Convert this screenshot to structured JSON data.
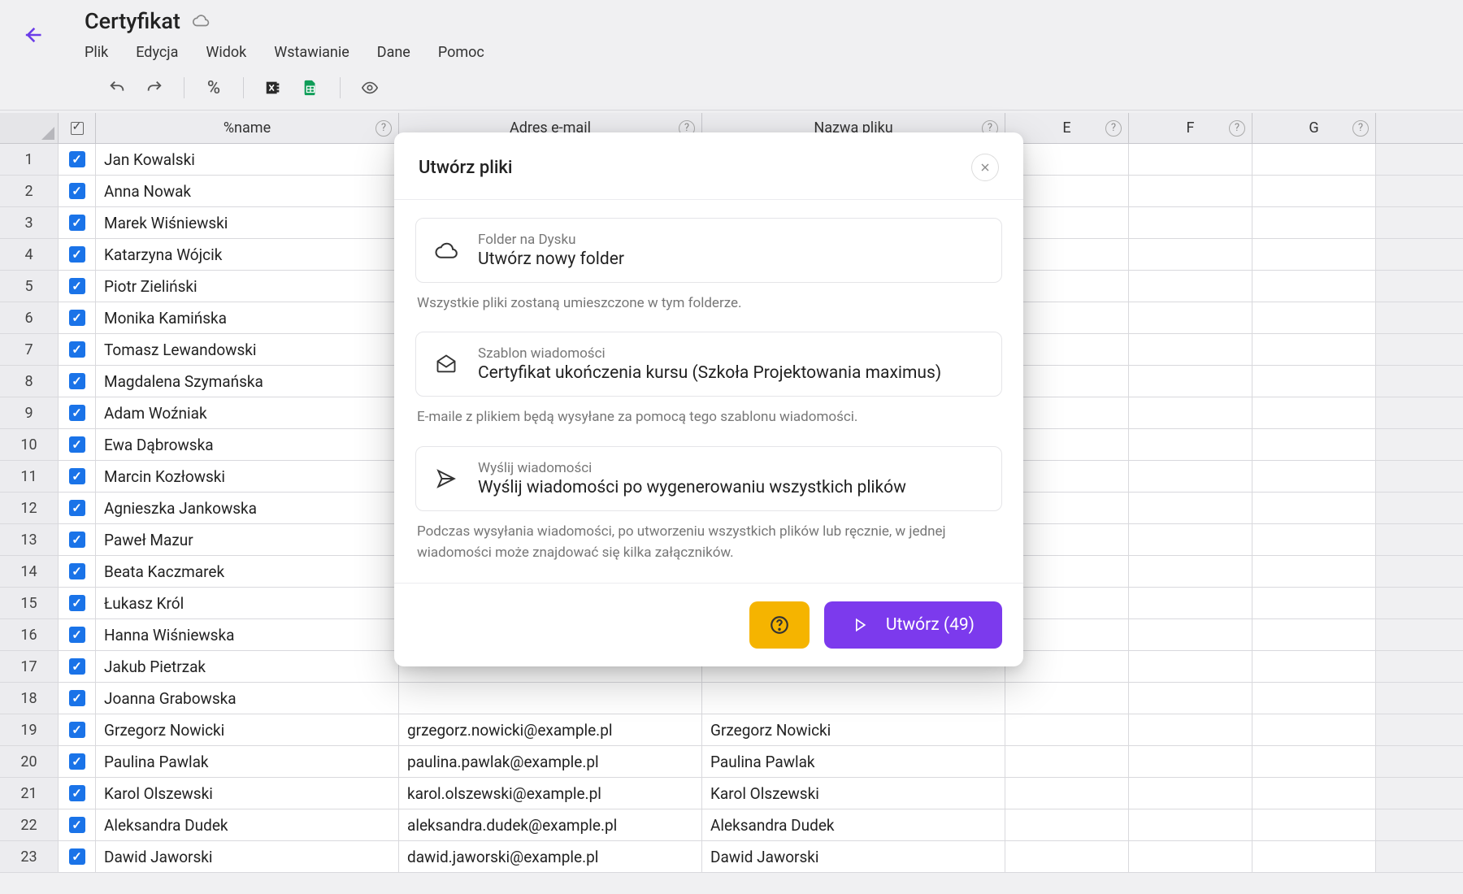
{
  "header": {
    "title": "Certyfikat",
    "menus": [
      "Plik",
      "Edycja",
      "Widok",
      "Wstawianie",
      "Dane",
      "Pomoc"
    ]
  },
  "columns": {
    "name": "%name",
    "email": "Adres e-mail",
    "file": "Nazwa pliku",
    "letters": [
      "E",
      "F",
      "G"
    ]
  },
  "rows": [
    {
      "n": "1",
      "name": "Jan Kowalski",
      "email": "",
      "file": ""
    },
    {
      "n": "2",
      "name": "Anna Nowak",
      "email": "",
      "file": ""
    },
    {
      "n": "3",
      "name": "Marek Wiśniewski",
      "email": "",
      "file": ""
    },
    {
      "n": "4",
      "name": "Katarzyna Wójcik",
      "email": "",
      "file": ""
    },
    {
      "n": "5",
      "name": "Piotr Zieliński",
      "email": "",
      "file": ""
    },
    {
      "n": "6",
      "name": "Monika Kamińska",
      "email": "",
      "file": ""
    },
    {
      "n": "7",
      "name": "Tomasz Lewandowski",
      "email": "",
      "file": ""
    },
    {
      "n": "8",
      "name": "Magdalena Szymańska",
      "email": "",
      "file": ""
    },
    {
      "n": "9",
      "name": "Adam Woźniak",
      "email": "",
      "file": ""
    },
    {
      "n": "10",
      "name": "Ewa Dąbrowska",
      "email": "",
      "file": ""
    },
    {
      "n": "11",
      "name": "Marcin Kozłowski",
      "email": "",
      "file": ""
    },
    {
      "n": "12",
      "name": "Agnieszka Jankowska",
      "email": "",
      "file": ""
    },
    {
      "n": "13",
      "name": "Paweł Mazur",
      "email": "",
      "file": ""
    },
    {
      "n": "14",
      "name": "Beata Kaczmarek",
      "email": "",
      "file": ""
    },
    {
      "n": "15",
      "name": "Łukasz Król",
      "email": "",
      "file": ""
    },
    {
      "n": "16",
      "name": "Hanna Wiśniewska",
      "email": "",
      "file": ""
    },
    {
      "n": "17",
      "name": "Jakub Pietrzak",
      "email": "",
      "file": ""
    },
    {
      "n": "18",
      "name": "Joanna Grabowska",
      "email": "",
      "file": ""
    },
    {
      "n": "19",
      "name": "Grzegorz Nowicki",
      "email": "grzegorz.nowicki@example.pl",
      "file": "Grzegorz Nowicki"
    },
    {
      "n": "20",
      "name": "Paulina Pawlak",
      "email": "paulina.pawlak@example.pl",
      "file": "Paulina Pawlak"
    },
    {
      "n": "21",
      "name": "Karol Olszewski",
      "email": "karol.olszewski@example.pl",
      "file": "Karol Olszewski"
    },
    {
      "n": "22",
      "name": "Aleksandra Dudek",
      "email": "aleksandra.dudek@example.pl",
      "file": "Aleksandra Dudek"
    },
    {
      "n": "23",
      "name": "Dawid Jaworski",
      "email": "dawid.jaworski@example.pl",
      "file": "Dawid Jaworski"
    }
  ],
  "modal": {
    "title": "Utwórz pliki",
    "folder": {
      "label": "Folder na Dysku",
      "value": "Utwórz nowy folder"
    },
    "folder_hint": "Wszystkie pliki zostaną umieszczone w tym folderze.",
    "template": {
      "label": "Szablon wiadomości",
      "value": "Certyfikat ukończenia kursu (Szkoła Projektowania maximus)"
    },
    "template_hint": "E-maile z plikiem będą wysyłane za pomocą tego szablonu wiadomości.",
    "send": {
      "label": "Wyślij wiadomości",
      "value": "Wyślij wiadomości po wygenerowaniu wszystkich plików"
    },
    "send_hint": "Podczas wysyłania wiadomości, po utworzeniu wszystkich plików lub ręcznie, w jednej wiadomości może znajdować się kilka załączników.",
    "create_btn": "Utwórz (49)"
  },
  "toolbar_percent": "%"
}
